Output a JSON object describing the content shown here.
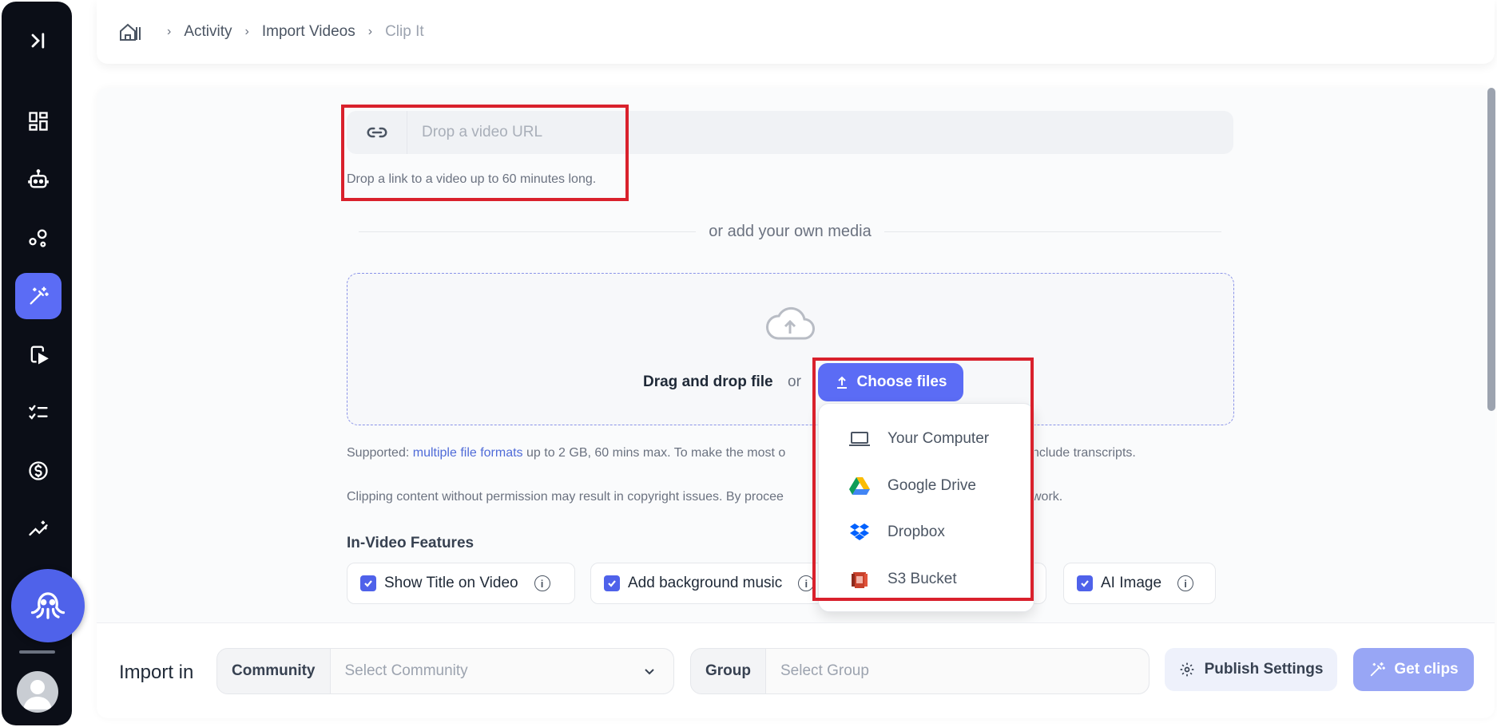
{
  "breadcrumb": {
    "items": [
      "Activity",
      "Import Videos",
      "Clip It"
    ]
  },
  "url_input": {
    "placeholder": "Drop a video URL",
    "hint": "Drop a link to a video up to 60 minutes long."
  },
  "divider_text": "or add your own media",
  "upload": {
    "drag_text": "Drag and drop file",
    "or_text": "or",
    "choose_label": "Choose files"
  },
  "supported": {
    "prefix": "Supported: ",
    "link": "multiple file formats",
    "text_a": " up to 2 GB, 60 mins max. To make the most o",
    "text_b": "nclude transcripts."
  },
  "clipping": {
    "text_a": "Clipping content without permission may result in copyright issues. By procee",
    "text_b": " work."
  },
  "features": {
    "title": "In-Video Features",
    "items": [
      {
        "label": "Show Title on Video",
        "checked": true
      },
      {
        "label": "Add background music",
        "checked": true
      },
      {
        "label": "AI Image",
        "checked": true
      }
    ]
  },
  "source_menu": {
    "items": [
      {
        "label": "Your Computer",
        "icon": "laptop-icon"
      },
      {
        "label": "Google Drive",
        "icon": "google-drive-icon"
      },
      {
        "label": "Dropbox",
        "icon": "dropbox-icon"
      },
      {
        "label": "S3 Bucket",
        "icon": "s3-bucket-icon"
      }
    ]
  },
  "footer": {
    "import_label": "Import in",
    "community_label": "Community",
    "community_placeholder": "Select Community",
    "group_label": "Group",
    "group_placeholder": "Select Group",
    "publish_label": "Publish Settings",
    "get_clips_label": "Get clips"
  },
  "colors": {
    "accent": "#5b6cf5",
    "sidebar_bg": "#0b0e17",
    "highlight": "#d9212c",
    "get_clips_bg": "#98a6f5"
  }
}
